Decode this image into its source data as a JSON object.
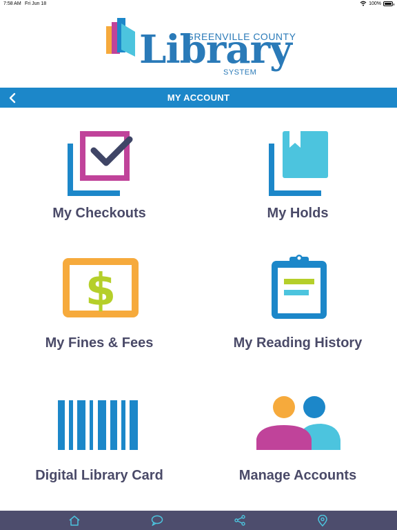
{
  "status_bar": {
    "time": "7:58 AM",
    "date": "Fri Jun 18",
    "battery": "100%"
  },
  "logo": {
    "top_text": "GREENVILLE COUNTY",
    "main_text": "Library",
    "bottom_text": "SYSTEM"
  },
  "nav": {
    "title": "MY ACCOUNT",
    "back_icon": "chevron-left-icon"
  },
  "tiles": [
    {
      "label": "My Checkouts",
      "icon": "checkout-checkbox-icon"
    },
    {
      "label": "My Holds",
      "icon": "bookmark-holds-icon"
    },
    {
      "label": "My Fines & Fees",
      "icon": "dollar-bill-icon"
    },
    {
      "label": "My Reading History",
      "icon": "clipboard-icon"
    },
    {
      "label": "Digital Library Card",
      "icon": "barcode-icon"
    },
    {
      "label": "Manage Accounts",
      "icon": "users-icon"
    }
  ],
  "tab_bar": {
    "items": [
      {
        "icon": "home-icon"
      },
      {
        "icon": "chat-bubble-icon"
      },
      {
        "icon": "share-icon"
      },
      {
        "icon": "location-pin-icon"
      }
    ]
  },
  "colors": {
    "brand_blue": "#1c87c9",
    "logo_blue": "#2a7ab8",
    "magenta": "#c0439a",
    "navy": "#3f4566",
    "light_blue": "#4cc4de",
    "orange": "#f6aa3c",
    "lime": "#b5cf2a",
    "tab_bar": "#4d4d6d",
    "label_text": "#4a4a68"
  }
}
